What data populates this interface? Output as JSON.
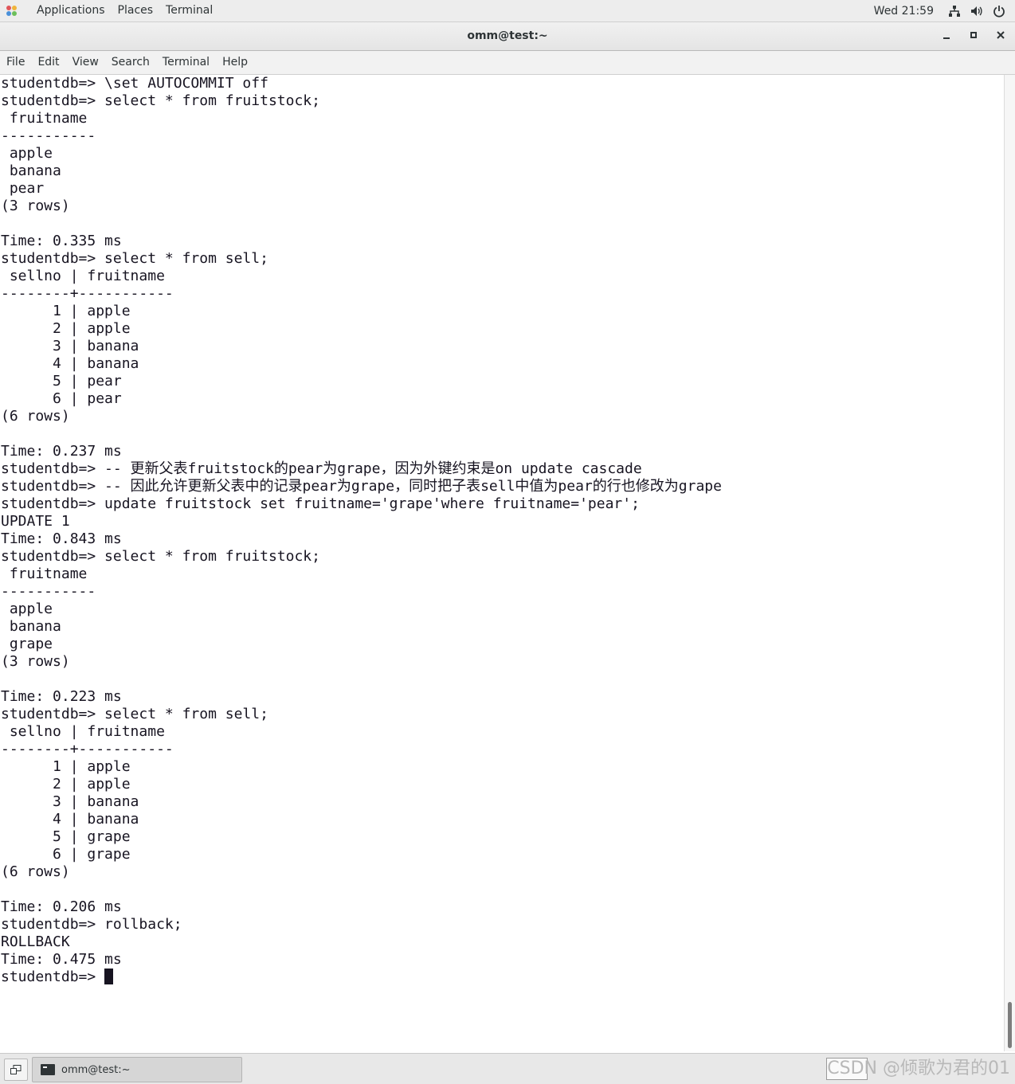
{
  "topbar": {
    "menus": [
      "Applications",
      "Places",
      "Terminal"
    ],
    "clock": "Wed 21:59"
  },
  "window": {
    "title": "omm@test:~",
    "menubar": [
      "File",
      "Edit",
      "View",
      "Search",
      "Terminal",
      "Help"
    ]
  },
  "terminal": {
    "lines": [
      "studentdb=> \\set AUTOCOMMIT off",
      "studentdb=> select * from fruitstock;",
      " fruitname",
      "-----------",
      " apple",
      " banana",
      " pear",
      "(3 rows)",
      "",
      "Time: 0.335 ms",
      "studentdb=> select * from sell;",
      " sellno | fruitname",
      "--------+-----------",
      "      1 | apple",
      "      2 | apple",
      "      3 | banana",
      "      4 | banana",
      "      5 | pear",
      "      6 | pear",
      "(6 rows)",
      "",
      "Time: 0.237 ms",
      "studentdb=> -- 更新父表fruitstock的pear为grape，因为外键约束是on update cascade",
      "studentdb=> -- 因此允许更新父表中的记录pear为grape，同时把子表sell中值为pear的行也修改为grape",
      "studentdb=> update fruitstock set fruitname='grape'where fruitname='pear';",
      "UPDATE 1",
      "Time: 0.843 ms",
      "studentdb=> select * from fruitstock;",
      " fruitname",
      "-----------",
      " apple",
      " banana",
      " grape",
      "(3 rows)",
      "",
      "Time: 0.223 ms",
      "studentdb=> select * from sell;",
      " sellno | fruitname",
      "--------+-----------",
      "      1 | apple",
      "      2 | apple",
      "      3 | banana",
      "      4 | banana",
      "      5 | grape",
      "      6 | grape",
      "(6 rows)",
      "",
      "Time: 0.206 ms",
      "studentdb=> rollback;",
      "ROLLBACK",
      "Time: 0.475 ms"
    ],
    "prompt": "studentdb=> "
  },
  "taskbar": {
    "task_label": "omm@test:~",
    "watermark": "CSDN @倾歌为君的01"
  },
  "icons": {
    "network": "network-icon",
    "volume": "volume-icon",
    "power": "power-icon"
  }
}
